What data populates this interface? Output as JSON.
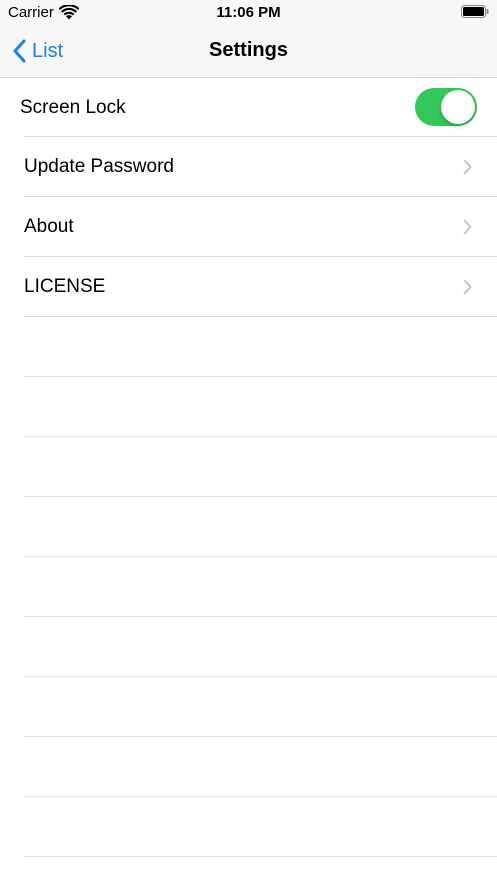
{
  "status_bar": {
    "carrier": "Carrier",
    "time": "11:06 PM",
    "wifi_icon": "wifi-icon",
    "battery_icon": "battery-icon"
  },
  "nav_bar": {
    "back_label": "List",
    "back_icon": "chevron-left-icon",
    "title": "Settings",
    "accent_color": "#1a7ef5"
  },
  "settings": {
    "screen_lock": {
      "label": "Screen Lock",
      "enabled": true,
      "toggle_color": "#34c759"
    },
    "rows": [
      {
        "label": "Update Password",
        "icon": "chevron-right-icon"
      },
      {
        "label": "About",
        "icon": "chevron-right-icon"
      },
      {
        "label": "LICENSE",
        "icon": "chevron-right-icon"
      }
    ]
  }
}
